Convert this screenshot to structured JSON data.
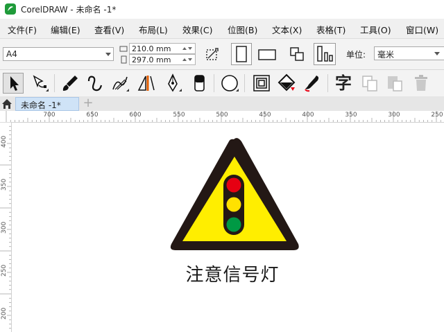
{
  "window": {
    "title": "CorelDRAW - 未命名 -1*"
  },
  "menu": [
    "文件(F)",
    "编辑(E)",
    "查看(V)",
    "布局(L)",
    "效果(C)",
    "位图(B)",
    "文本(X)",
    "表格(T)",
    "工具(O)",
    "窗口(W)"
  ],
  "propertybar": {
    "page_size": "A4",
    "width": "210.0 mm",
    "height": "297.0 mm",
    "units_label": "单位:",
    "units_value": "毫米"
  },
  "tabs": {
    "document": "未命名 -1*",
    "add": "+"
  },
  "ruler": {
    "h_labels": [
      "700",
      "650",
      "600",
      "550",
      "500",
      "450",
      "400",
      "350",
      "300",
      "250"
    ],
    "v_labels": [
      "400",
      "350",
      "300",
      "250",
      "200"
    ]
  },
  "canvas": {
    "sign_text": "注意信号灯",
    "colors": {
      "triangle_fill": "#ffee00",
      "triangle_border": "#231815",
      "red": "#e60012",
      "yellow": "#ffe100",
      "green": "#009944"
    }
  },
  "icons": [
    "home-icon",
    "pick-tool-icon",
    "shape-tool-icon",
    "artistic-media-icon",
    "freehand-icon",
    "smart-drawing-icon",
    "dimension-icon",
    "pen-icon",
    "eraser-icon",
    "ellipse-icon",
    "contour-icon",
    "fill-icon",
    "eyedropper-icon",
    "text-tool-icon",
    "copy-icon",
    "paste-icon",
    "delete-icon"
  ]
}
